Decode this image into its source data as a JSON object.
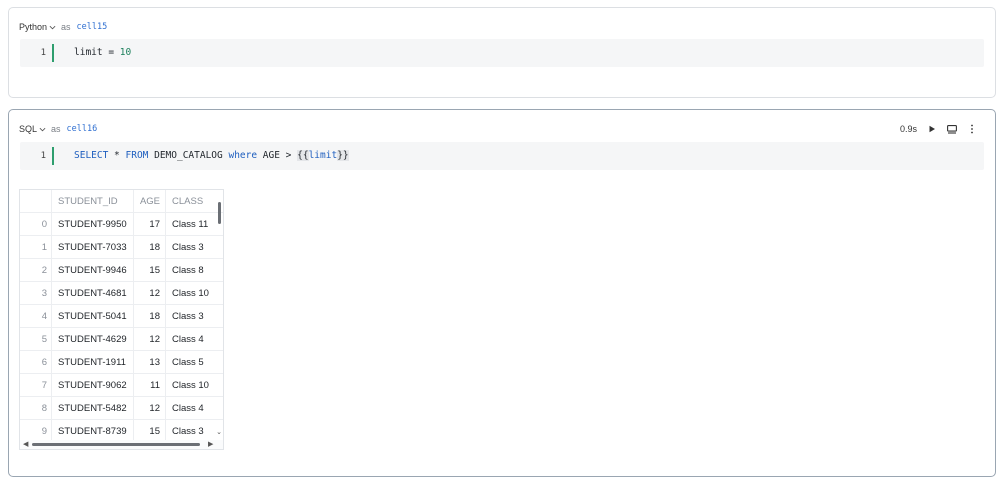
{
  "cells": [
    {
      "language": "Python",
      "as_word": "as",
      "name": "cell15",
      "line_number": "1",
      "code": {
        "var": "limit",
        "op": " = ",
        "value": "10"
      }
    },
    {
      "language": "SQL",
      "as_word": "as",
      "name": "cell16",
      "runtime": "0.9s",
      "line_number": "1",
      "code": {
        "kw1": "SELECT",
        "p1": " * ",
        "kw2": "FROM",
        "p2": " DEMO_CATALOG ",
        "kw3": "where",
        "p3": " AGE > ",
        "open": "{{",
        "var": "limit",
        "close": "}}"
      },
      "toolbar_icons": [
        "run-icon",
        "display-mode-icon",
        "more-vertical-icon"
      ]
    }
  ],
  "result_table": {
    "columns": [
      "",
      "STUDENT_ID",
      "AGE",
      "CLASS"
    ],
    "rows": [
      [
        "0",
        "STUDENT-9950",
        "17",
        "Class 11"
      ],
      [
        "1",
        "STUDENT-7033",
        "18",
        "Class 3"
      ],
      [
        "2",
        "STUDENT-9946",
        "15",
        "Class 8"
      ],
      [
        "3",
        "STUDENT-4681",
        "12",
        "Class 10"
      ],
      [
        "4",
        "STUDENT-5041",
        "18",
        "Class 3"
      ],
      [
        "5",
        "STUDENT-4629",
        "12",
        "Class 4"
      ],
      [
        "6",
        "STUDENT-1911",
        "13",
        "Class 5"
      ],
      [
        "7",
        "STUDENT-9062",
        "11",
        "Class 10"
      ],
      [
        "8",
        "STUDENT-5482",
        "12",
        "Class 4"
      ],
      [
        "9",
        "STUDENT-8739",
        "15",
        "Class 3"
      ]
    ]
  },
  "colors": {
    "keyword": "#1f5fbf",
    "number": "#1a7f5a",
    "cell_name": "#2f6fd1",
    "gutter": "#2e9e6e"
  }
}
